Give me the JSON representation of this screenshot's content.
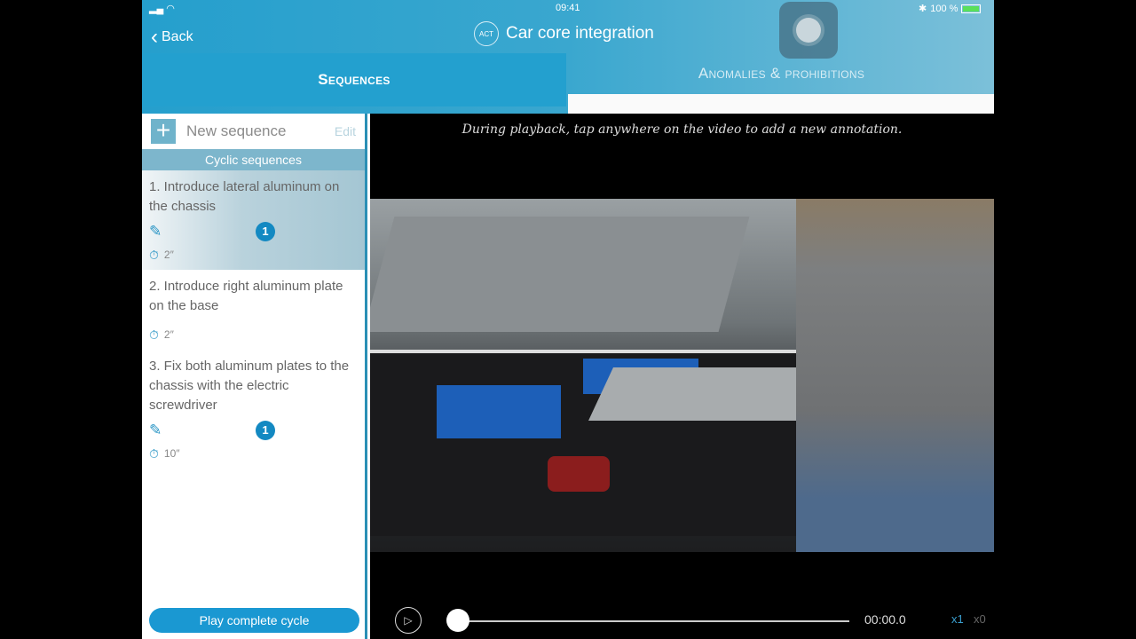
{
  "status": {
    "time": "09:41",
    "battery": "100 %"
  },
  "header": {
    "back": "Back",
    "logo": "ACT",
    "title": "Car core integration"
  },
  "tabs": [
    {
      "label": "Sequences"
    },
    {
      "label": "Anomalies & prohibitions"
    }
  ],
  "sidebar": {
    "new_sequence": "New sequence",
    "edit": "Edit",
    "section": "Cyclic sequences",
    "items": [
      {
        "title": "1. Introduce lateral aluminum on the chassis",
        "badge": "1",
        "time": "2″"
      },
      {
        "title": "2. Introduce right aluminum plate on the base",
        "time": "2″"
      },
      {
        "title": "3. Fix both aluminum plates to the chassis with the electric screwdriver",
        "badge": "1",
        "time": "10″"
      }
    ],
    "play_cycle": "Play complete cycle"
  },
  "video": {
    "hint": "During playback, tap anywhere on the video to add a new annotation.",
    "timecode": "00:00.0",
    "speed_1": "x1",
    "speed_0": "x0",
    "progress": 0
  }
}
